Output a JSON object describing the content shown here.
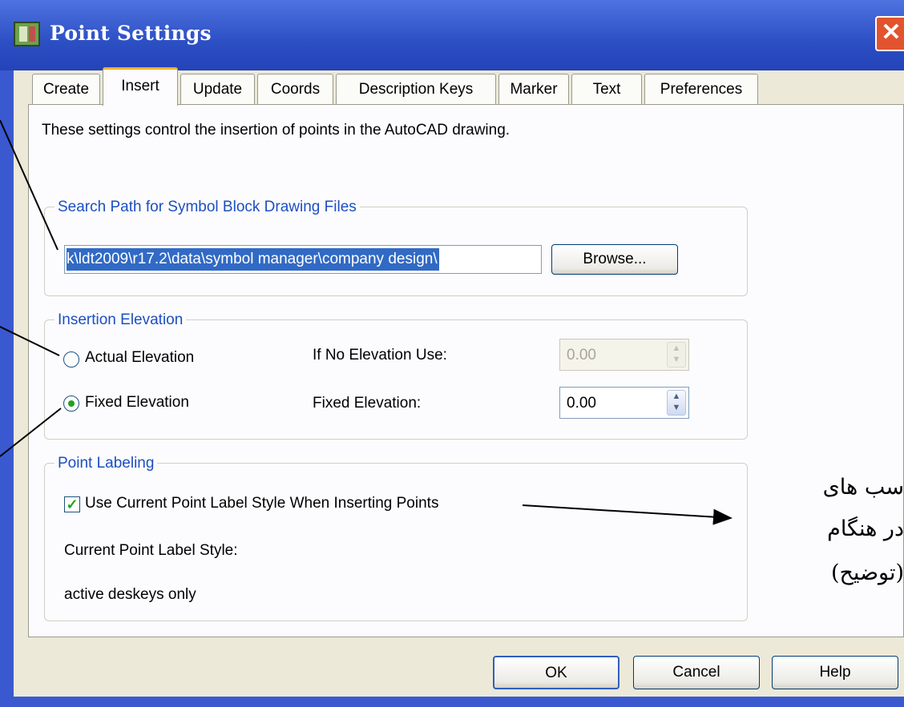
{
  "window": {
    "title": "Point Settings",
    "close_glyph": "✕"
  },
  "tabs": [
    {
      "label": "Create"
    },
    {
      "label": "Insert"
    },
    {
      "label": "Update"
    },
    {
      "label": "Coords"
    },
    {
      "label": "Description Keys"
    },
    {
      "label": "Marker"
    },
    {
      "label": "Text"
    },
    {
      "label": "Preferences"
    }
  ],
  "panel": {
    "description": "These settings control the insertion of points in the AutoCAD drawing.",
    "search_path": {
      "group_label": "Search Path for Symbol Block Drawing Files",
      "path_value": "k\\ldt2009\\r17.2\\data\\symbol manager\\company design\\",
      "browse_label": "Browse..."
    },
    "insertion_elevation": {
      "group_label": "Insertion Elevation",
      "actual_label": "Actual Elevation",
      "fixed_label": "Fixed Elevation",
      "selected": "Fixed Elevation",
      "if_no_label": "If No Elevation Use:",
      "if_no_value": "0.00",
      "fixed_field_label": "Fixed Elevation:",
      "fixed_value": "0.00"
    },
    "point_labeling": {
      "group_label": "Point Labeling",
      "checkbox_label": "Use Current Point Label Style When Inserting Points",
      "checked": true,
      "current_style_label": "Current Point Label Style:",
      "current_style_value": "active deskeys only"
    }
  },
  "buttons": {
    "ok": "OK",
    "cancel": "Cancel",
    "help": "Help"
  },
  "annotation": {
    "line1": "سب های",
    "line2": "در هنگام",
    "line3": "(توضیح)"
  },
  "colors": {
    "title_bar": "#2c4fc4",
    "group_label": "#1d4fc0",
    "selection": "#316ac5",
    "dialog_bg": "#ece9d8"
  }
}
